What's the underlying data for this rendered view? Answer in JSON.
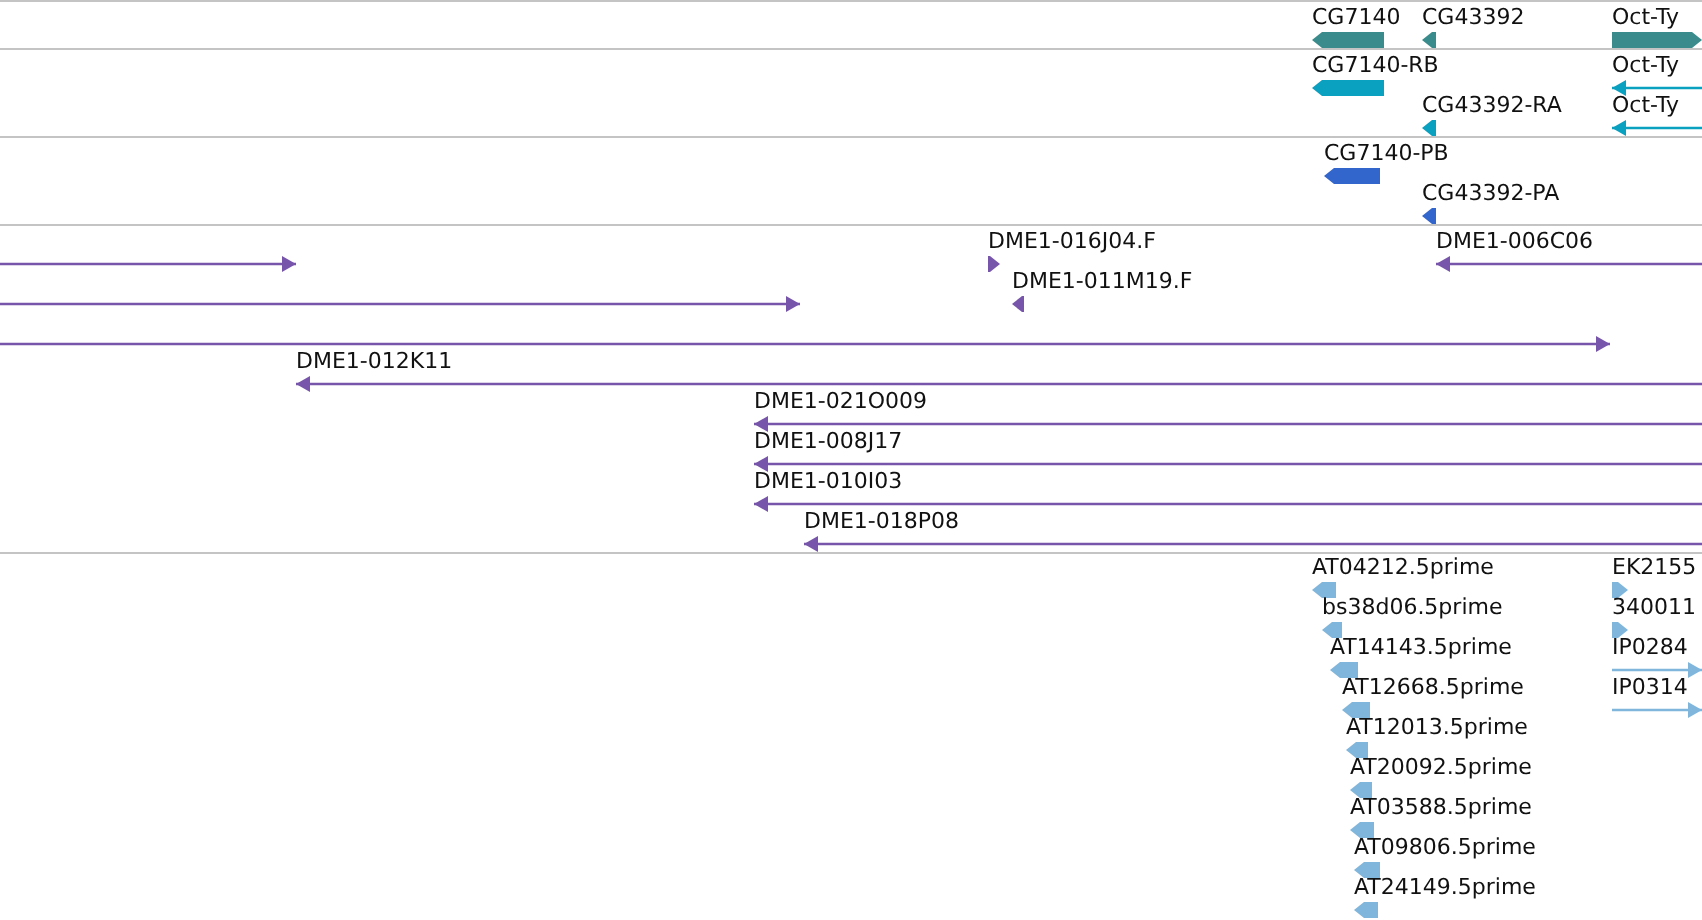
{
  "tracks": [
    {
      "color": "#3a8c8c",
      "features": [
        {
          "label": "CG7140",
          "kind": "block",
          "reverse": true
        },
        {
          "label": "CG43392",
          "kind": "block",
          "reverse": true
        },
        {
          "label": "Oct-Ty",
          "kind": "block",
          "reverse": false
        }
      ]
    },
    {
      "color": "#0aa0c0",
      "features": [
        {
          "label": "CG7140-RB",
          "kind": "block",
          "reverse": true
        },
        {
          "label": "CG43392-RA",
          "kind": "block",
          "reverse": true
        },
        {
          "label": "Oct-Ty",
          "kind": "line",
          "reverse": true
        },
        {
          "label": "Oct-Ty",
          "kind": "line",
          "reverse": true
        }
      ]
    },
    {
      "color": "#3366cc",
      "features": [
        {
          "label": "CG7140-PB",
          "kind": "block",
          "reverse": true
        },
        {
          "label": "CG43392-PA",
          "kind": "block",
          "reverse": true
        }
      ]
    },
    {
      "color": "#7755aa",
      "features": [
        {
          "kind": "line",
          "reverse": false
        },
        {
          "label": "DME1-016J04.F",
          "kind": "block",
          "reverse": false
        },
        {
          "label": "DME1-006C06",
          "kind": "line",
          "reverse": true
        },
        {
          "kind": "line",
          "reverse": false
        },
        {
          "label": "DME1-011M19.F",
          "kind": "block",
          "reverse": true
        },
        {
          "kind": "line",
          "reverse": false
        },
        {
          "label": "DME1-012K11",
          "kind": "line",
          "reverse": true
        },
        {
          "label": "DME1-021O009",
          "kind": "line",
          "reverse": true
        },
        {
          "label": "DME1-008J17",
          "kind": "line",
          "reverse": true
        },
        {
          "label": "DME1-010I03",
          "kind": "line",
          "reverse": true
        },
        {
          "label": "DME1-018P08",
          "kind": "line",
          "reverse": true
        }
      ]
    },
    {
      "color": "#80b6dc",
      "features": [
        {
          "label": "AT04212.5prime",
          "kind": "block",
          "reverse": true
        },
        {
          "label": "bs38d06.5prime",
          "kind": "block",
          "reverse": true
        },
        {
          "label": "AT14143.5prime",
          "kind": "block",
          "reverse": true
        },
        {
          "label": "AT12668.5prime",
          "kind": "block",
          "reverse": true
        },
        {
          "label": "AT12013.5prime",
          "kind": "block",
          "reverse": true
        },
        {
          "label": "AT20092.5prime",
          "kind": "block",
          "reverse": true
        },
        {
          "label": "AT03588.5prime",
          "kind": "block",
          "reverse": true
        },
        {
          "label": "AT09806.5prime",
          "kind": "block",
          "reverse": true
        },
        {
          "label": "AT24149.5prime",
          "kind": "block",
          "reverse": true
        },
        {
          "label": "EK2155",
          "kind": "block",
          "reverse": false
        },
        {
          "label": "340011",
          "kind": "block",
          "reverse": false
        },
        {
          "label": "IP0284",
          "kind": "line",
          "reverse": false
        },
        {
          "label": "IP0314",
          "kind": "line",
          "reverse": false
        }
      ]
    }
  ]
}
